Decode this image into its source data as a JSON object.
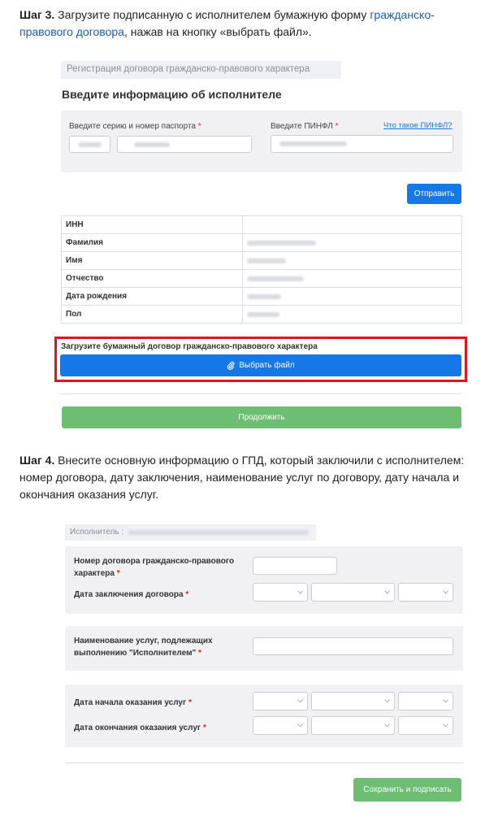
{
  "step3": {
    "label": "Шаг 3.",
    "text_before": " Загрузите подписанную с исполнителем бумажную форму ",
    "link_text": "гражданско-правового договора",
    "text_after": ", нажав на кнопку «выбрать файл»."
  },
  "form1": {
    "header": "Регистрация договора гражданско-правового характера",
    "title": "Введите информацию об исполнителе",
    "passport_label": "Введите серию и номер паспорта",
    "pinfl_label": "Введите ПИНФЛ",
    "required_mark": "*",
    "pinfl_help_link": "Что такое ПИНФЛ?",
    "submit_label": "Отправить",
    "table_rows": [
      {
        "key": "ИНН"
      },
      {
        "key": "Фамилия"
      },
      {
        "key": "Имя"
      },
      {
        "key": "Отчество"
      },
      {
        "key": "Дата рождения"
      },
      {
        "key": "Пол"
      }
    ],
    "upload_label": "Загрузите бумажный договор гражданско-правового характера",
    "choose_file_label": "Выбрать файл",
    "continue_label": "Продолжить",
    "highlight_color": "#e0141e"
  },
  "step4": {
    "label": "Шаг 4.",
    "text": " Внесите основную информацию о ГПД, который заключили с исполнителем: номер договора, дату заключения, наименование услуг по договору, дату начала и окончания оказания услуг."
  },
  "form2": {
    "executor_label": "Исполнитель :",
    "contract_number_label": "Номер договора гражданско-правового характера",
    "contract_date_label": "Дата заключения договора",
    "services_label": "Наименование услуг, подлежащих выполнению \"Исполнителем\"",
    "start_date_label": "Дата начала оказания услуг",
    "end_date_label": "Дата окончания оказания услуг",
    "required_mark": "*",
    "save_sign_label": "Сохранить и подписать"
  },
  "colors": {
    "accent": "#1677e6",
    "success": "#6dbd73",
    "link": "#1b5fae"
  }
}
